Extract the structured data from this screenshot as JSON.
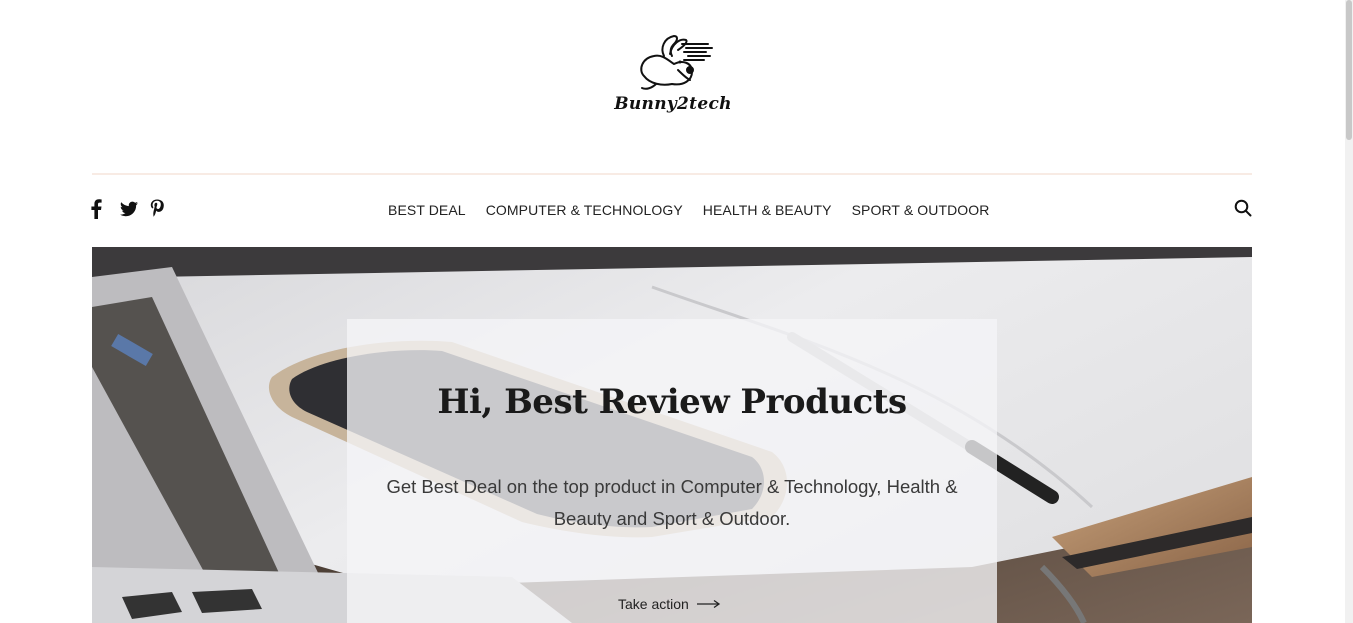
{
  "brand": {
    "logo_text": "Bunny2tech",
    "logo_icon": "running-rabbit-icon"
  },
  "social": [
    {
      "name": "facebook-icon"
    },
    {
      "name": "twitter-icon"
    },
    {
      "name": "pinterest-icon"
    }
  ],
  "nav": {
    "items": [
      {
        "label": "BEST DEAL"
      },
      {
        "label": "COMPUTER & TECHNOLOGY"
      },
      {
        "label": "HEALTH & BEAUTY"
      },
      {
        "label": "SPORT & OUTDOOR"
      }
    ],
    "search_icon": "search-icon"
  },
  "hero": {
    "title": "Hi, Best Review Products",
    "text": "Get Best Deal on the top product in Computer & Technology, Health & Beauty and Sport & Outdoor.",
    "action_label": "Take action",
    "action_icon": "arrow-right-icon"
  },
  "colors": {
    "divider": "#f8ebe4",
    "text": "#222222",
    "card": "#f5f5f7"
  }
}
